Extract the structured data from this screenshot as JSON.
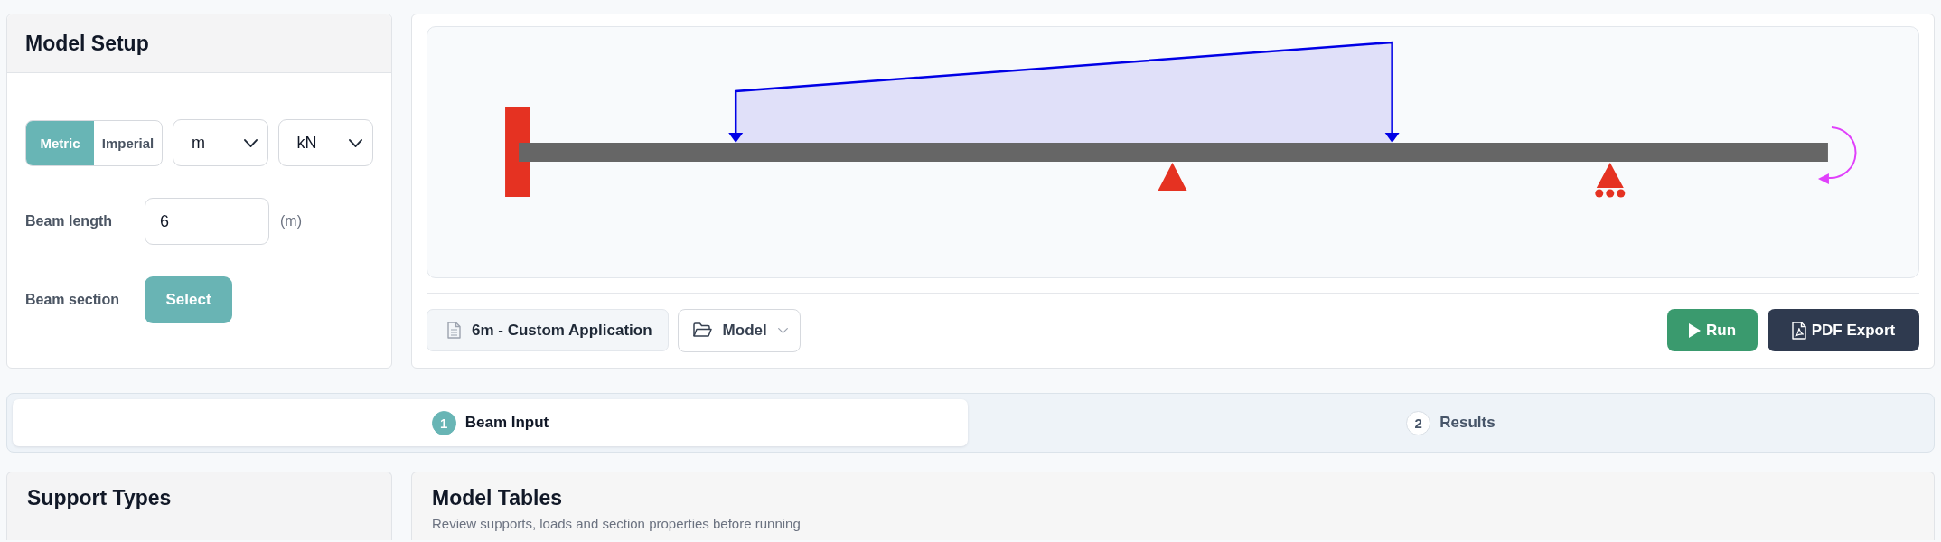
{
  "model_setup": {
    "title": "Model Setup",
    "unit_system": [
      {
        "label": "Metric",
        "selected": true
      },
      {
        "label": "Imperial",
        "selected": false
      }
    ],
    "length_unit": "m",
    "force_unit": "kN",
    "beam_length": {
      "label": "Beam length",
      "value": "6",
      "unit": "(m)"
    },
    "beam_section": {
      "label": "Beam section",
      "button": "Select"
    }
  },
  "toolbar": {
    "project_name": "6m - Custom Application",
    "model_menu": "Model",
    "buttons": [
      {
        "kind": "run",
        "label": "Run"
      },
      {
        "kind": "pdf",
        "label": "PDF Export"
      }
    ]
  },
  "steps": [
    {
      "number": "1",
      "label": "Beam Input",
      "selected": true
    },
    {
      "number": "2",
      "label": "Results",
      "selected": false
    }
  ],
  "support_types": {
    "title": "Support Types"
  },
  "model_tables": {
    "title": "Model Tables",
    "subtitle": "Review supports, loads and section properties before running"
  }
}
